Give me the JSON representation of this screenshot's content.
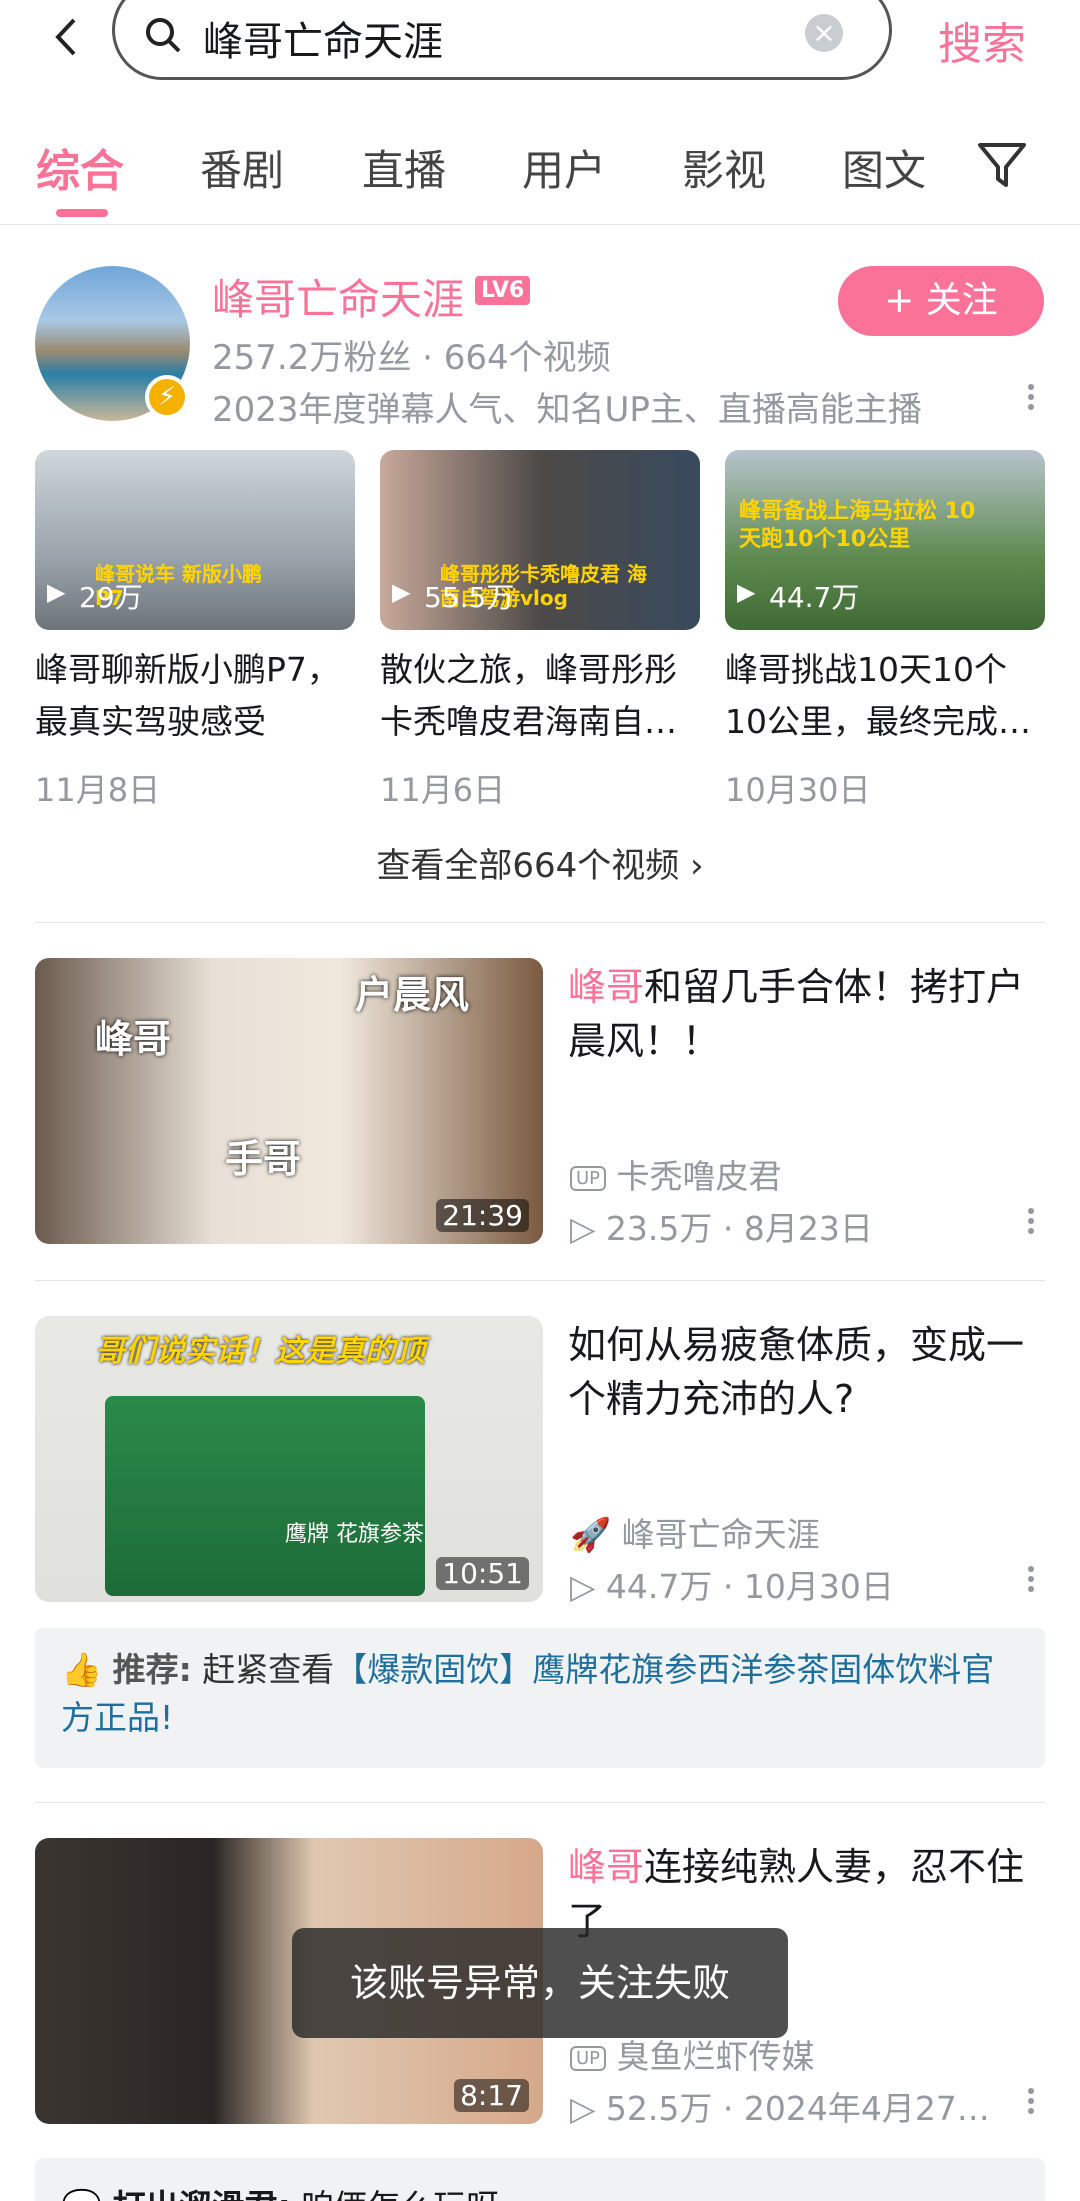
{
  "search": {
    "query": "峰哥亡命天涯",
    "submit": "搜索"
  },
  "tabs": [
    "综合",
    "番剧",
    "直播",
    "用户",
    "影视",
    "图文"
  ],
  "up": {
    "name": "峰哥亡命天涯",
    "level": "LV6",
    "stats": "257.2万粉丝 · 664个视频",
    "tags": "2023年度弹幕人气、知名UP主、直播高能主播",
    "follow": "+ 关注",
    "videos": [
      {
        "views": "29万",
        "title": "峰哥聊新版小鹏P7，最真实驾驶感受",
        "date": "11月8日",
        "cap": "峰哥说车 新版小鹏P7"
      },
      {
        "views": "55.5万",
        "title": "散伙之旅，峰哥彤彤卡秃噜皮君海南自…",
        "date": "11月6日",
        "cap": "峰哥彤彤卡秃噜皮君 海南自驾游vlog"
      },
      {
        "views": "44.7万",
        "title": "峰哥挑战10天10个10公里，最终完成…",
        "date": "10月30日",
        "cap": "峰哥备战上海马拉松 10天跑10个10公里"
      }
    ],
    "view_all": "查看全部664个视频"
  },
  "results": [
    {
      "hl": "峰哥",
      "title": "和留几手合体！拷打户晨风！！",
      "author": "卡秃噜皮君",
      "meta": "23.5万 · 8月23日",
      "dur": "21:39",
      "t1": "峰哥",
      "t2": "户晨风",
      "t3": "手哥"
    },
    {
      "hl": "",
      "title": "如何从易疲惫体质，变成一个精力充沛的人?",
      "author": "峰哥亡命天涯",
      "meta": "44.7万 · 10月30日",
      "dur": "10:51",
      "t1": "哥们说实话！这是真的顶",
      "t2": "鹰牌 花旗参茶"
    },
    {
      "hl": "峰哥",
      "title": "连接纯熟人妻，忍不住了",
      "author": "臭鱼烂虾传媒",
      "meta": "52.5万 · 2024年4月27…",
      "dur": "8:17"
    }
  ],
  "ad": {
    "label": "推荐:",
    "pre": "赶紧查看",
    "link": "【爆款固饮】鹰牌花旗参西洋参茶固体饮料官方正品!"
  },
  "next": {
    "label": "打出溜滑君:",
    "text": "咱俩怎么玩呀"
  },
  "toast": "该账号异常，关注失败",
  "colors": {
    "accent": "#fb7299",
    "link": "#1f6f9c"
  }
}
